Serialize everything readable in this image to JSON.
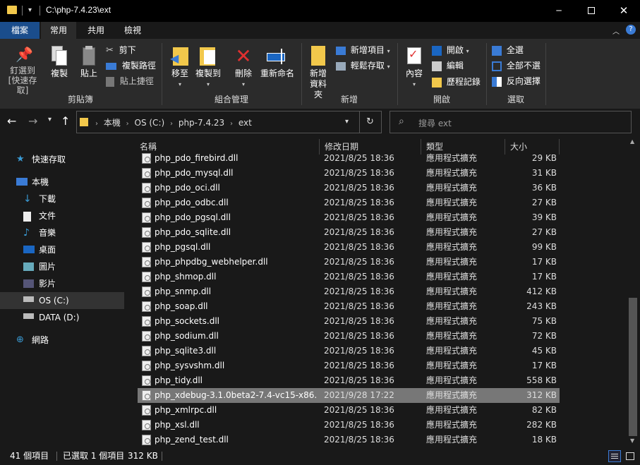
{
  "titlebar": {
    "path": "C:\\php-7.4.23\\ext"
  },
  "ribbon_tabs": [
    "檔案",
    "常用",
    "共用",
    "檢視"
  ],
  "ribbon": {
    "pin": "釘選到 [快速存取]",
    "copy": "複製",
    "paste": "貼上",
    "cut": "剪下",
    "copy_path": "複製路徑",
    "paste_shortcut": "貼上捷徑",
    "group_clipboard": "剪貼簿",
    "move_to": "移至",
    "copy_to": "複製到",
    "delete": "刪除",
    "rename": "重新命名",
    "group_organize": "組合管理",
    "new_folder": "新增資料夾",
    "new_item": "新增項目",
    "easy_access": "輕鬆存取",
    "group_new": "新增",
    "properties": "內容",
    "open": "開啟",
    "edit": "編輯",
    "history": "歷程記錄",
    "group_open": "開啟",
    "select_all": "全選",
    "select_none": "全部不選",
    "invert_selection": "反向選擇",
    "group_select": "選取"
  },
  "address": {
    "crumbs": [
      "本機",
      "OS (C:)",
      "php-7.4.23",
      "ext"
    ],
    "search_placeholder": "搜尋 ext"
  },
  "nav": [
    {
      "label": "快速存取",
      "icon": "star-icon"
    },
    {
      "label": "本機",
      "icon": "computer-icon"
    },
    {
      "label": "下載",
      "icon": "download-icon"
    },
    {
      "label": "文件",
      "icon": "document-icon"
    },
    {
      "label": "音樂",
      "icon": "music-icon"
    },
    {
      "label": "桌面",
      "icon": "desktop-icon"
    },
    {
      "label": "圖片",
      "icon": "pictures-icon"
    },
    {
      "label": "影片",
      "icon": "videos-icon"
    },
    {
      "label": "OS (C:)",
      "icon": "drive-icon"
    },
    {
      "label": "DATA (D:)",
      "icon": "drive-icon"
    },
    {
      "label": "網路",
      "icon": "network-icon"
    }
  ],
  "columns": {
    "name": "名稱",
    "date": "修改日期",
    "type": "類型",
    "size": "大小"
  },
  "files": [
    {
      "name": "php_pdo_firebird.dll",
      "date": "2021/8/25 18:36",
      "type": "應用程式擴充",
      "size": "29 KB"
    },
    {
      "name": "php_pdo_mysql.dll",
      "date": "2021/8/25 18:36",
      "type": "應用程式擴充",
      "size": "31 KB"
    },
    {
      "name": "php_pdo_oci.dll",
      "date": "2021/8/25 18:36",
      "type": "應用程式擴充",
      "size": "36 KB"
    },
    {
      "name": "php_pdo_odbc.dll",
      "date": "2021/8/25 18:36",
      "type": "應用程式擴充",
      "size": "27 KB"
    },
    {
      "name": "php_pdo_pgsql.dll",
      "date": "2021/8/25 18:36",
      "type": "應用程式擴充",
      "size": "39 KB"
    },
    {
      "name": "php_pdo_sqlite.dll",
      "date": "2021/8/25 18:36",
      "type": "應用程式擴充",
      "size": "27 KB"
    },
    {
      "name": "php_pgsql.dll",
      "date": "2021/8/25 18:36",
      "type": "應用程式擴充",
      "size": "99 KB"
    },
    {
      "name": "php_phpdbg_webhelper.dll",
      "date": "2021/8/25 18:36",
      "type": "應用程式擴充",
      "size": "17 KB"
    },
    {
      "name": "php_shmop.dll",
      "date": "2021/8/25 18:36",
      "type": "應用程式擴充",
      "size": "17 KB"
    },
    {
      "name": "php_snmp.dll",
      "date": "2021/8/25 18:36",
      "type": "應用程式擴充",
      "size": "412 KB"
    },
    {
      "name": "php_soap.dll",
      "date": "2021/8/25 18:36",
      "type": "應用程式擴充",
      "size": "243 KB"
    },
    {
      "name": "php_sockets.dll",
      "date": "2021/8/25 18:36",
      "type": "應用程式擴充",
      "size": "75 KB"
    },
    {
      "name": "php_sodium.dll",
      "date": "2021/8/25 18:36",
      "type": "應用程式擴充",
      "size": "72 KB"
    },
    {
      "name": "php_sqlite3.dll",
      "date": "2021/8/25 18:36",
      "type": "應用程式擴充",
      "size": "45 KB"
    },
    {
      "name": "php_sysvshm.dll",
      "date": "2021/8/25 18:36",
      "type": "應用程式擴充",
      "size": "17 KB"
    },
    {
      "name": "php_tidy.dll",
      "date": "2021/8/25 18:36",
      "type": "應用程式擴充",
      "size": "558 KB"
    },
    {
      "name": "php_xdebug-3.1.0beta2-7.4-vc15-x86...",
      "date": "2021/9/28 17:22",
      "type": "應用程式擴充",
      "size": "312 KB",
      "selected": true
    },
    {
      "name": "php_xmlrpc.dll",
      "date": "2021/8/25 18:36",
      "type": "應用程式擴充",
      "size": "82 KB"
    },
    {
      "name": "php_xsl.dll",
      "date": "2021/8/25 18:36",
      "type": "應用程式擴充",
      "size": "282 KB"
    },
    {
      "name": "php_zend_test.dll",
      "date": "2021/8/25 18:36",
      "type": "應用程式擴充",
      "size": "18 KB"
    }
  ],
  "status": {
    "count": "41 個項目",
    "selection": "已選取 1 個項目",
    "size": "312 KB"
  }
}
